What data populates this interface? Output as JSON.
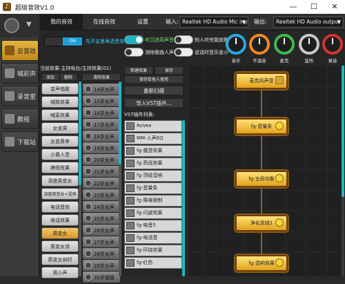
{
  "window": {
    "title": "超级音效V1.0",
    "icon_glyph": "♪",
    "min": "—",
    "max": "☐",
    "close": "✕"
  },
  "sidebar": {
    "items": [
      {
        "label": "云音效",
        "active": true
      },
      {
        "label": "喊彩声",
        "active": false
      },
      {
        "label": "录音室",
        "active": false
      },
      {
        "label": "教程",
        "active": false
      },
      {
        "label": "下载站",
        "active": false
      }
    ]
  },
  "tabs": [
    {
      "label": "我的音效",
      "active": true
    },
    {
      "label": "在线音效",
      "active": false
    },
    {
      "label": "设置",
      "active": false
    }
  ],
  "devices": {
    "input_label": "输入:",
    "input_value": "Realtek HD Audio Mic input",
    "output_label": "输出:",
    "output_value": "Realtek HD Audio output"
  },
  "controls": {
    "on_label": "ON",
    "enable_label": "先开这里再选音效",
    "options": [
      {
        "label": "听沉迷简声音",
        "on": true
      },
      {
        "label": "别人听完我放歌",
        "on": false
      },
      {
        "label": "消除歌曲人声",
        "on": false
      },
      {
        "label": "说话时音乐变小",
        "on": false
      }
    ]
  },
  "knobs": [
    {
      "label": "音乐",
      "color": "#29a9e0"
    },
    {
      "label": "不混音",
      "color": "#f08a24"
    },
    {
      "label": "麦克",
      "color": "#3dba4e"
    },
    {
      "label": "监听",
      "color": "#c9c9c9"
    },
    {
      "label": "录音",
      "color": "#d0352d"
    }
  ],
  "list": {
    "header": "当前效果:主持电台/主持效果(01)",
    "add": "添加",
    "remove": "删除",
    "clear": "清除效果"
  },
  "effects": [
    "变声唱歌",
    "喊歌效果",
    "喊麦效果",
    "女变男",
    "女变男李",
    "小黄人音",
    "搞怪效果",
    "深度男变女",
    "深度男变女+混响",
    "电话音效",
    "电话效果",
    "男变女",
    "男变女诗",
    "男变女如时",
    "男小声"
  ],
  "effects_active_index": 11,
  "voices": [
    "14岁女声",
    "15岁女声",
    "16岁女声",
    "17岁女声",
    "18岁女声",
    "19岁女声",
    "20岁女声",
    "21岁女声",
    "22岁女声",
    "23岁女声",
    "24岁女声",
    "25岁女声",
    "26岁女声",
    "27岁女声",
    "28岁女声",
    "29岁女声",
    "30岁御姐"
  ],
  "vst": {
    "new_label": "新建效果",
    "save_label": "保存",
    "save_as_label": "保存给他人使用",
    "rescan_label": "重新扫描",
    "import_label": "导入VST插件...",
    "list_title": "VST插件列表:",
    "plugins": [
      "RoVee",
      "MM-人声EQ",
      "fg-魔音效果",
      "fg-高低效果",
      "fg-顶级混响",
      "fg-音量条",
      "fg-降噪限制",
      "fg-闪避效果",
      "fg-电音5",
      "fg-电话音",
      "fg-环绕效果",
      "fg-红色"
    ]
  },
  "chain": {
    "nodes": [
      "麦克风声音",
      "fg-音量条",
      "fg-五段均衡",
      "净化双线1",
      "fg-混响效果"
    ]
  }
}
